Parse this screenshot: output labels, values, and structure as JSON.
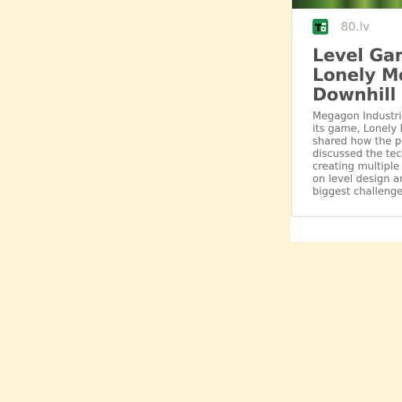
{
  "card": {
    "source": {
      "name": "80.lv",
      "logo_icon": "80lv-logo-icon",
      "logo_color": "#1f8e4a"
    },
    "title_lines": [
      "Level Gam",
      "Lonely Mo",
      "Downhill"
    ],
    "excerpt_lines": [
      "Megagon Industri",
      "its game, Lonely M",
      "shared how the p",
      "discussed the tec",
      "creating multiple",
      "on level design ar",
      "biggest challenge"
    ]
  },
  "colors": {
    "background": "#fff5d6",
    "card": "#ffffff",
    "title": "#4f4f4f",
    "excerpt": "#6e6e6e",
    "source": "#a9a59a"
  }
}
